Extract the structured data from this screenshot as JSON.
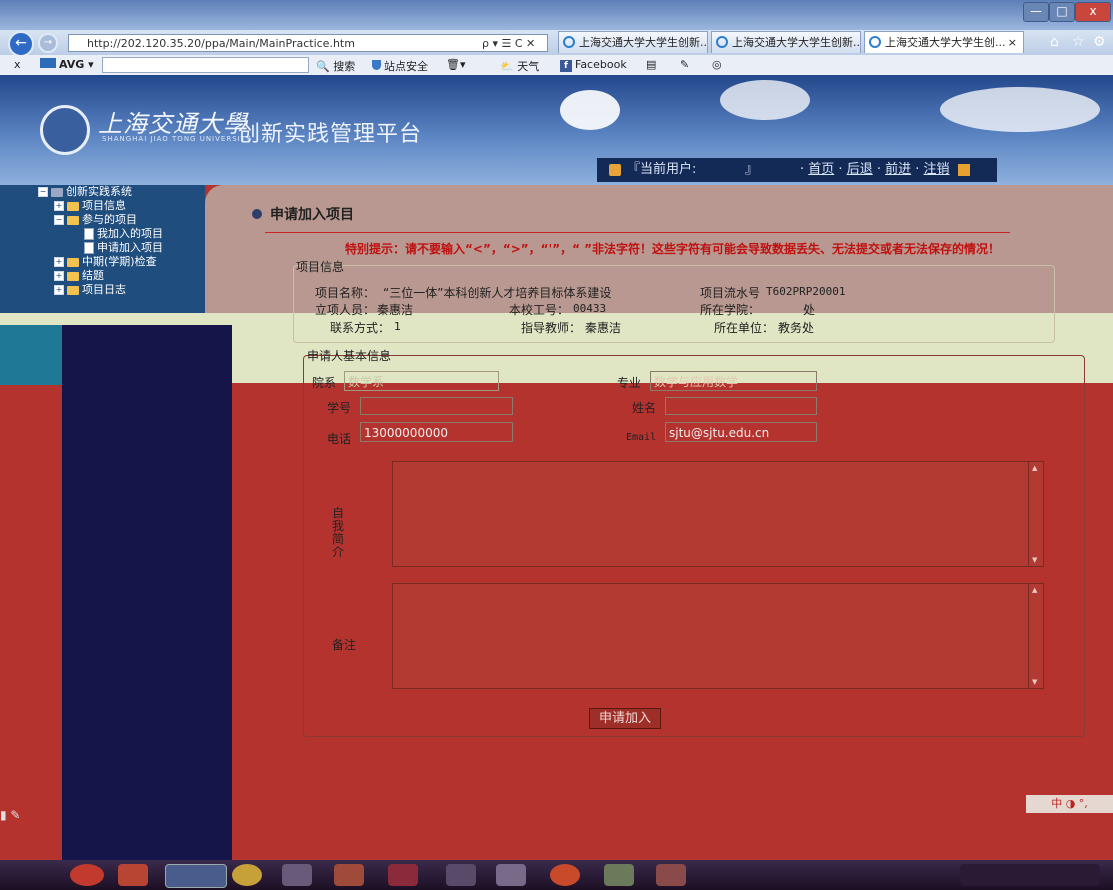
{
  "browser": {
    "url": "http://202.120.35.20/ppa/Main/MainPractice.htm",
    "search_controls": "ρ ▾ ☰ C ✕",
    "tabs": [
      {
        "label": "上海交通大学大学生创新..."
      },
      {
        "label": "上海交通大学大学生创新..."
      },
      {
        "label": "上海交通大学大学生创...",
        "close": "×"
      }
    ],
    "window_buttons": {
      "minimize": "—",
      "maximize": "□",
      "close": "x"
    }
  },
  "toolbar": {
    "close": "x",
    "avg": "AVG ▾",
    "search": "搜索",
    "site_security": "站点安全",
    "weather": "天气",
    "facebook": "Facebook"
  },
  "header": {
    "logo_text": "上海交通大學",
    "logo_en": "SHANGHAI JIAO TONG UNIVERSITY",
    "platform_title": "创新实践管理平台",
    "current_user_label": "『当前用户:",
    "current_user_value": "』",
    "nav": {
      "home": "首页",
      "back": "后退",
      "forward": "前进",
      "logout": "注销"
    }
  },
  "tree": {
    "root": "创新实践系统",
    "items": [
      {
        "label": "项目信息",
        "level": 1
      },
      {
        "label": "参与的项目",
        "level": 1
      },
      {
        "label": "我加入的项目",
        "level": 2
      },
      {
        "label": "申请加入项目",
        "level": 2
      },
      {
        "label": "中期(学期)检查",
        "level": 1
      },
      {
        "label": "结题",
        "level": 1
      },
      {
        "label": "项目日志",
        "level": 1
      }
    ]
  },
  "page": {
    "title": "申请加入项目",
    "warning": "特别提示：请不要输入“<”，“>”，“'”，“ ”非法字符！这些字符有可能会导致数据丢失、无法提交或者无法保存的情况！"
  },
  "project_info": {
    "legend": "项目信息",
    "name_label": "项目名称：",
    "name_value": "“三位一体”本科创新人才培养目标体系建设",
    "serial_label": "项目流水号",
    "serial_value": "T602PRP20001",
    "creator_label": "立项人员：",
    "creator_value": "秦惠洁",
    "staff_no_label": "本校工号：",
    "staff_no_value": "00433",
    "college_label": "所在学院：",
    "college_value": "处",
    "contact_label": "联系方式：",
    "contact_value": "1",
    "advisor_label": "指导教师：",
    "advisor_value": "秦惠洁",
    "unit_label": "所在单位：",
    "unit_value": "教务处"
  },
  "applicant": {
    "legend": "申请人基本信息",
    "department_label": "院系",
    "department_value": "数学系",
    "major_label": "专业",
    "major_value": "数学与应用数学",
    "student_no_label": "学号",
    "student_no_value": "",
    "name_label": "姓名",
    "name_value": "",
    "phone_label": "电话",
    "phone_value": "13000000000",
    "email_label": "Email",
    "email_value": "sjtu@sjtu.edu.cn",
    "intro_label": "自我简介",
    "remark_label": "备注",
    "submit_label": "申请加入"
  },
  "ime": {
    "label": "中 ◑ °,"
  }
}
